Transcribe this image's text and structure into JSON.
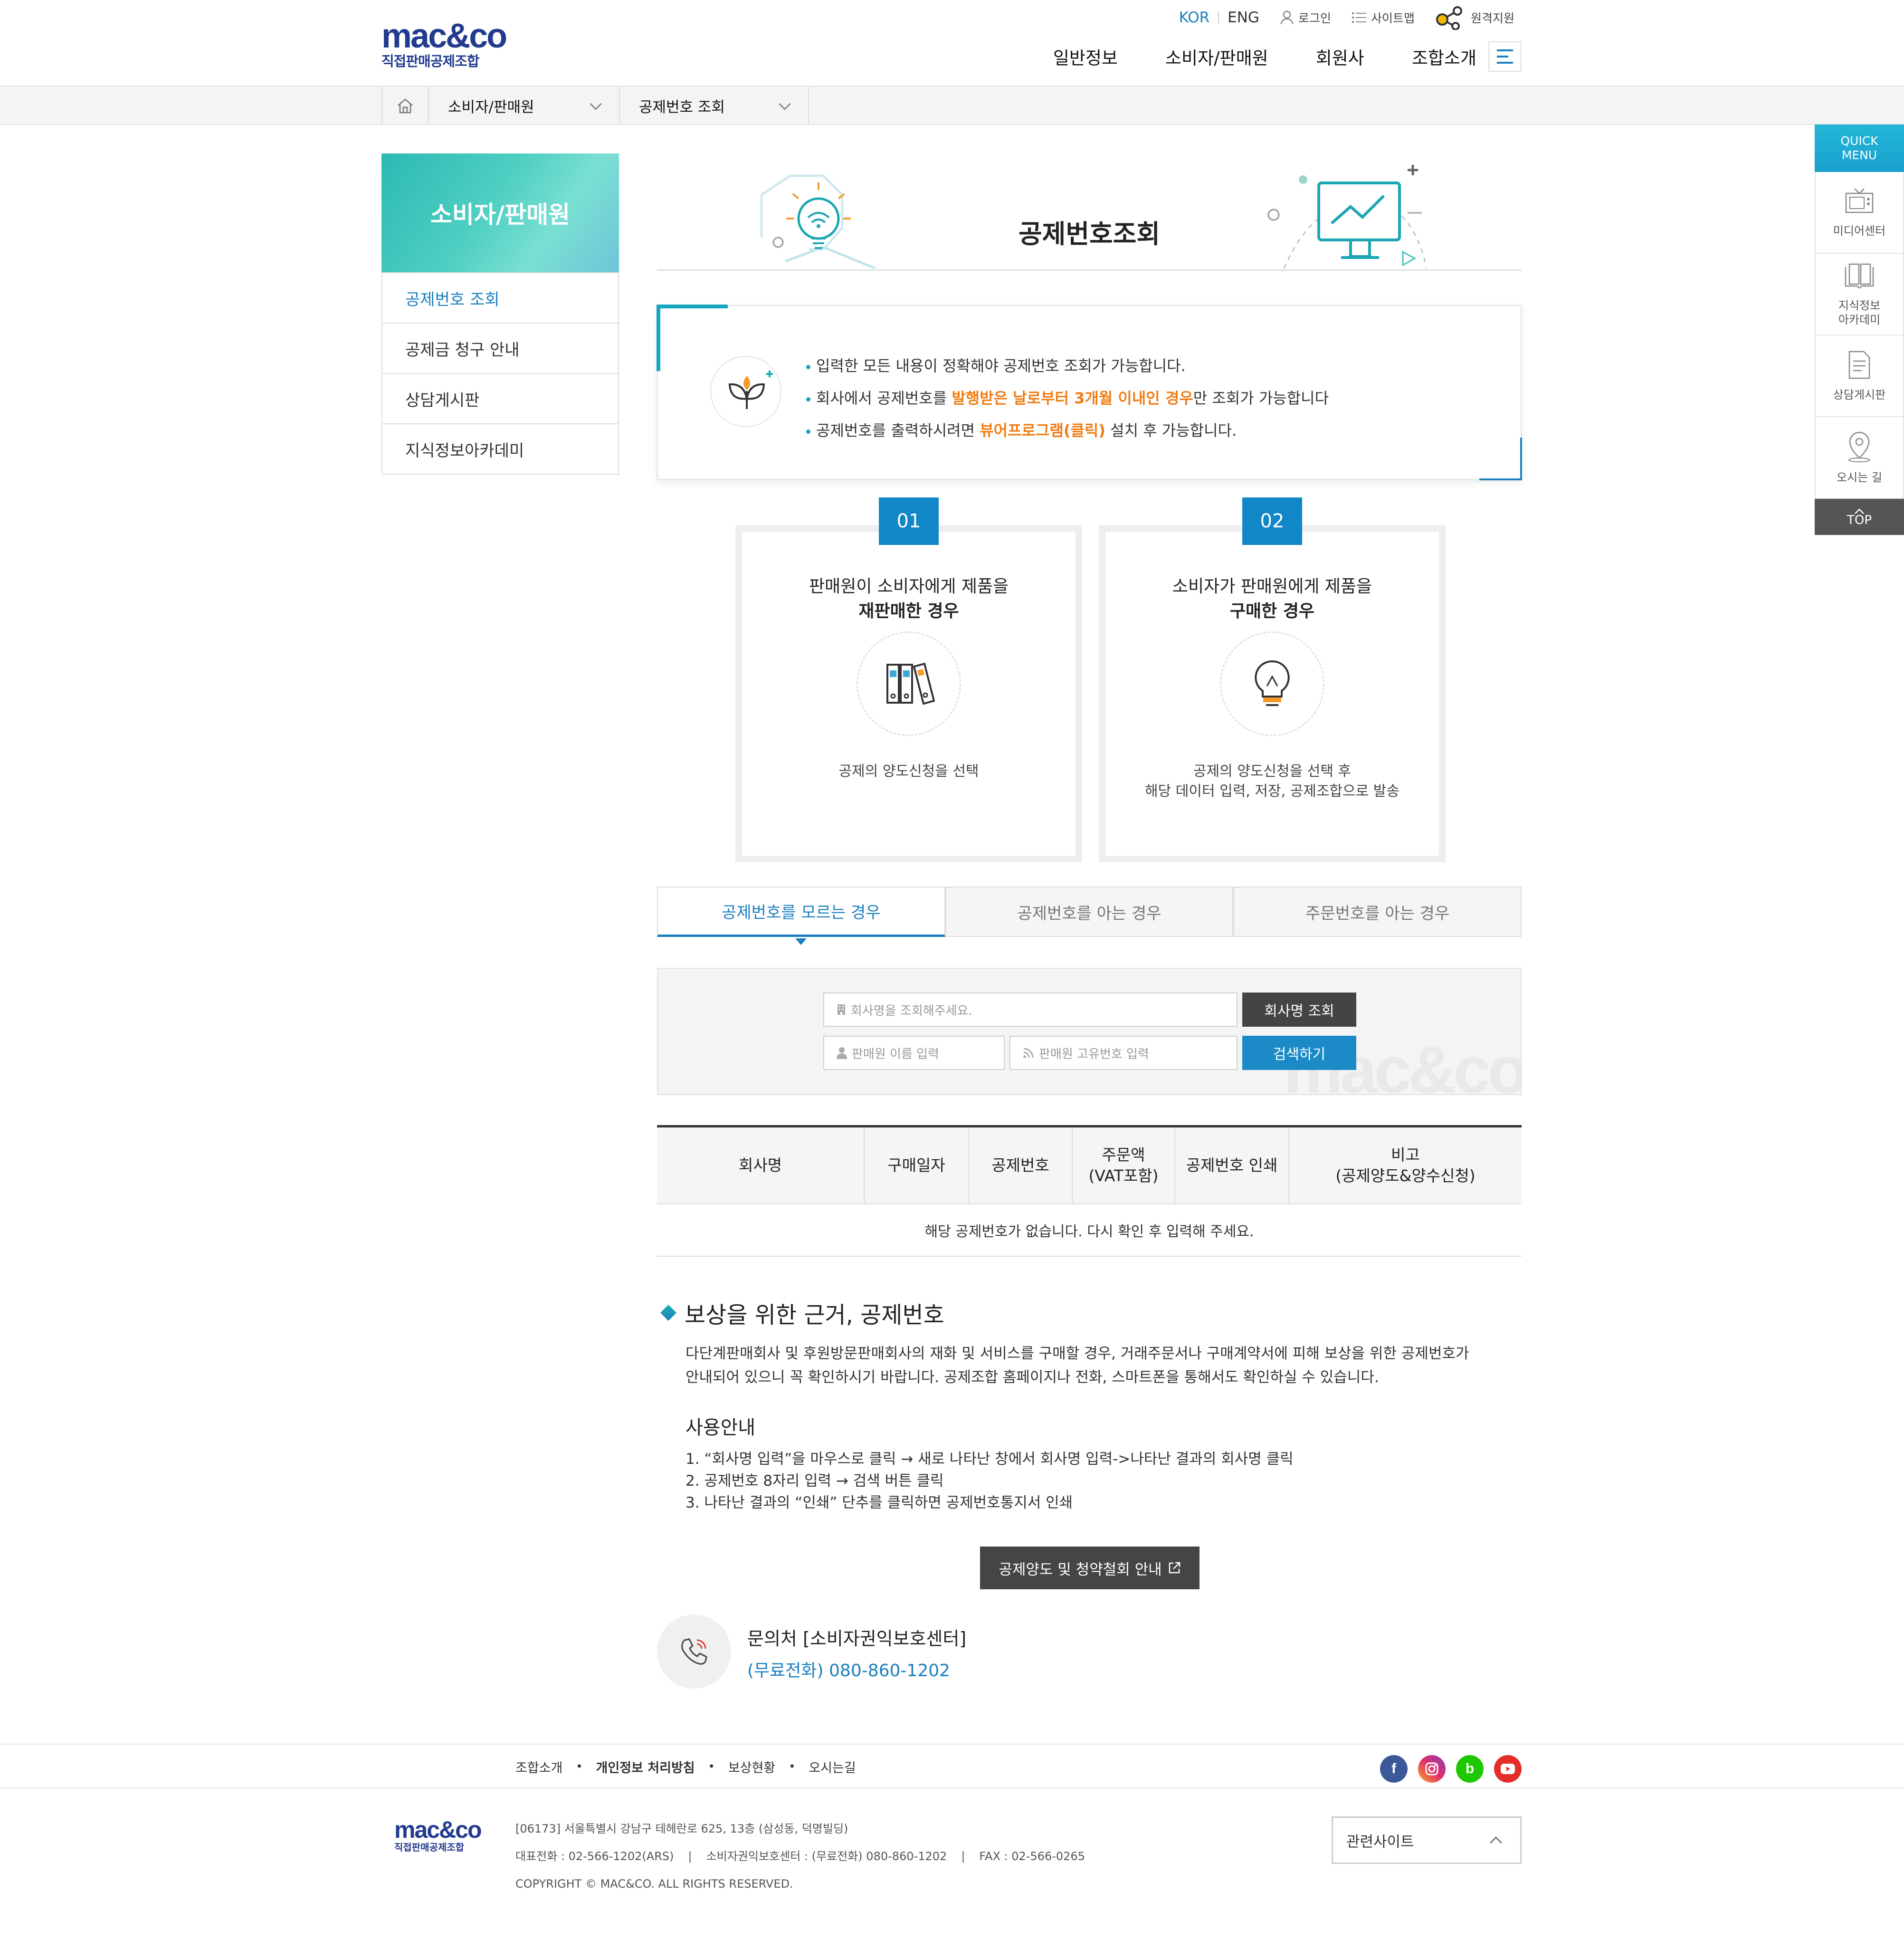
{
  "header": {
    "logo_text": "mac&co",
    "logo_sub": "직접판매공제조합",
    "lang_active": "KOR",
    "lang_other": "ENG",
    "login": "로그인",
    "sitemap": "사이트맵",
    "remote": "원격지원",
    "nav": [
      "일반정보",
      "소비자/판매원",
      "회원사",
      "조합소개"
    ]
  },
  "breadcrumb": {
    "level1": "소비자/판매원",
    "level2": "공제번호 조회"
  },
  "sidebar": {
    "title": "소비자/판매원",
    "items": [
      {
        "label": "공제번호 조회"
      },
      {
        "label": "공제금 청구 안내"
      },
      {
        "label": "상담게시판"
      },
      {
        "label": "지식정보아카데미"
      }
    ]
  },
  "page": {
    "title": "공제번호조회"
  },
  "notice": {
    "line1": "입력한 모든 내용이 정확해야 공제번호 조회가 가능합니다.",
    "line2_a": "회사에서 공제번호를 ",
    "line2_hl": "발행받은 날로부터 3개월 이내인 경우",
    "line2_b": "만 조회가 가능합니다",
    "line3_a": "공제번호를 출력하시려면 ",
    "line3_hl": "뷰어프로그램(클릭)",
    "line3_b": " 설치 후 가능합니다."
  },
  "cases": [
    {
      "num": "01",
      "line1": "판매원이 소비자에게 제품을",
      "line2": "재판매한 경우",
      "desc1": "공제의 양도신청을 선택",
      "desc2": ""
    },
    {
      "num": "02",
      "line1": "소비자가 판매원에게 제품을",
      "line2": "구매한 경우",
      "desc1": "공제의 양도신청을 선택 후",
      "desc2": "해당 데이터 입력, 저장, 공제조합으로 발송"
    }
  ],
  "tabs": [
    {
      "label": "공제번호를 모르는 경우"
    },
    {
      "label": "공제번호를 아는 경우"
    },
    {
      "label": "주문번호를 아는 경우"
    }
  ],
  "search": {
    "company_placeholder": "회사명을 조회해주세요.",
    "company_button": "회사명 조회",
    "name_placeholder": "판매원 이름 입력",
    "id_placeholder": "판매원 고유번호 입력",
    "search_button": "검색하기",
    "watermark": "mac&co"
  },
  "result": {
    "headers": [
      "회사명",
      "구매일자",
      "공제번호",
      "주문액",
      "(VAT포함)",
      "공제번호 인쇄",
      "비고",
      "(공제양도&양수신청)"
    ],
    "empty": "해당 공제번호가 없습니다. 다시 확인 후 입력해 주세요."
  },
  "basis": {
    "title": "보상을 위한 근거, 공제번호",
    "desc1": "다단계판매회사 및 후원방문판매회사의 재화 및 서비스를 구매할 경우, 거래주문서나 구매계약서에 피해 보상을 위한 공제번호가",
    "desc2": "안내되어 있으니 꼭 확인하시기 바랍니다. 공제조합 홈페이지나 전화, 스마트폰을 통해서도 확인하실 수 있습니다.",
    "usage_title": "사용안내",
    "usage": [
      "1. “회사명 입력”을 마우스로 클릭 → 새로 나타난 창에서 회사명 입력->나타난 결과의 회사명 클릭",
      "2. 공제번호 8자리 입력 → 검색 버튼 클릭",
      "3. 나타난 결과의 “인쇄” 단추를 클릭하면 공제번호통지서 인쇄"
    ],
    "guide_button": "공제양도 및 청약철회 안내"
  },
  "contact": {
    "label": "문의처 [소비자권익보호센터]",
    "phone": "(무료전화) 080-860-1202"
  },
  "quick_menu": {
    "head1": "QUICK",
    "head2": "MENU",
    "items": [
      {
        "label": "미디어센터",
        "label2": ""
      },
      {
        "label": "지식정보",
        "label2": "아카데미"
      },
      {
        "label": "상담게시판",
        "label2": ""
      },
      {
        "label": "오시는 길",
        "label2": ""
      }
    ],
    "top": "TOP"
  },
  "footer": {
    "links": [
      "조합소개",
      "개인정보 처리방침",
      "보상현황",
      "오시는길"
    ],
    "sns": [
      "f",
      "b"
    ],
    "logo_text": "mac&co",
    "logo_sub": "직접판매공제조합",
    "address": "[06173] 서울특별시 강남구 테헤란로 625, 13층 (삼성동, 덕명빌딩)",
    "tel": "대표전화 : 02-566-1202(ARS)",
    "center": "소비자권익보호센터 : (무료전화) 080-860-1202",
    "fax": "FAX : 02-566-0265",
    "copyright": "COPYRIGHT © MAC&CO. ALL RIGHTS RESERVED.",
    "related": "관련사이트"
  },
  "colors": {
    "accent": "#1b7fbf",
    "highlight": "#f07c13",
    "brand": "#233b8f",
    "teal": "#2cb9b4"
  }
}
